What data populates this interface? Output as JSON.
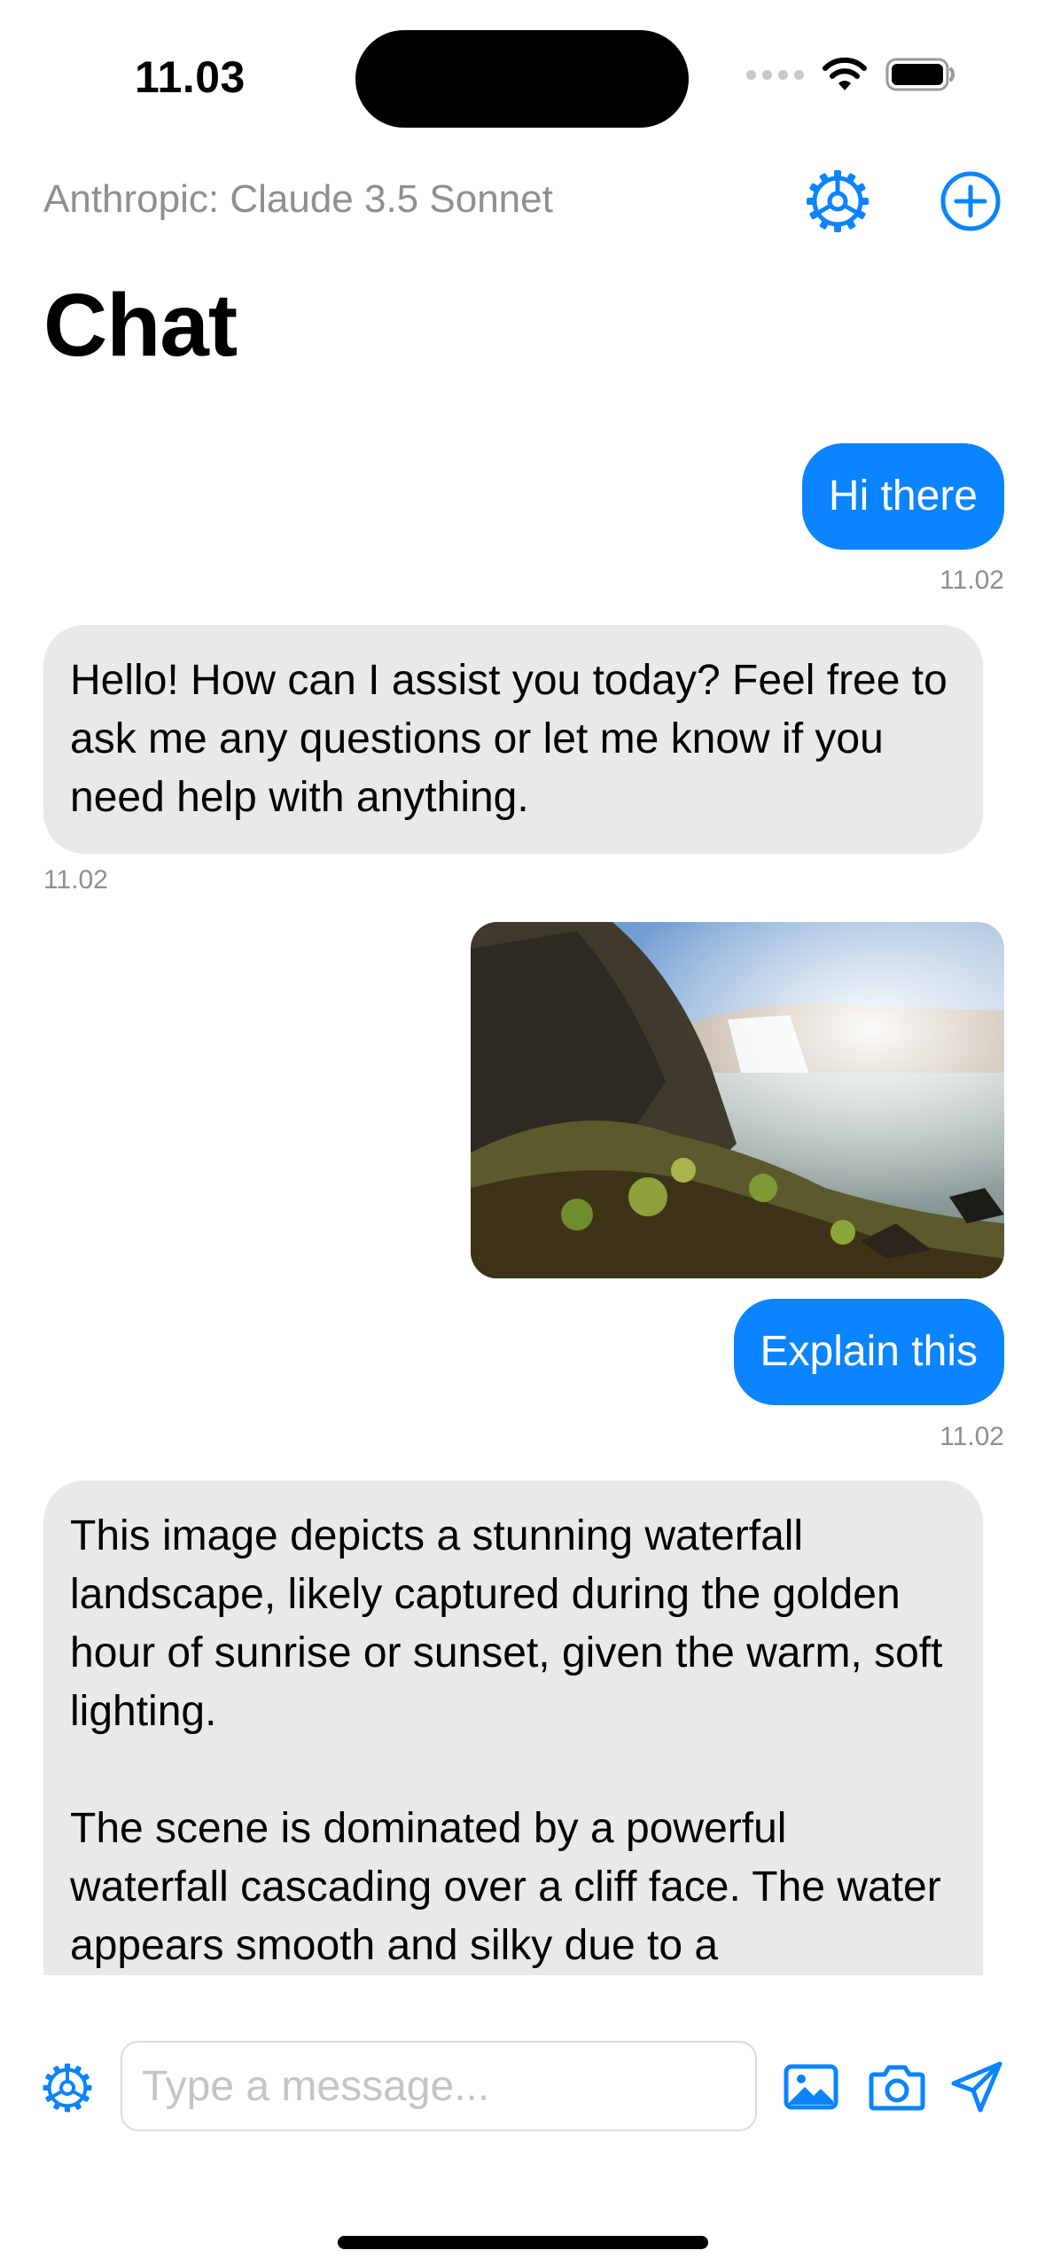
{
  "status": {
    "time": "11.03"
  },
  "nav": {
    "model_label": "Anthropic: Claude 3.5 Sonnet",
    "title": "Chat",
    "settings_icon": "gear-icon",
    "new_chat_icon": "plus-circle-icon"
  },
  "messages": [
    {
      "role": "user",
      "text": "Hi there",
      "time": "11.02"
    },
    {
      "role": "assistant",
      "text": "Hello! How can I assist you today? Feel free to ask me any questions or let me know if you need help with anything.",
      "time": "11.02"
    },
    {
      "role": "user",
      "image": "waterfall-landscape-photo",
      "text": "Explain this",
      "time": "11.02"
    },
    {
      "role": "assistant",
      "paragraphs": [
        "This image depicts a stunning waterfall landscape, likely captured during the golden hour of sunrise or sunset, given the warm, soft lighting.",
        "The scene is dominated by a powerful waterfall cascading over a cliff face. The water appears smooth and silky due to a"
      ]
    }
  ],
  "input": {
    "placeholder": "Type a message..."
  },
  "colors": {
    "accent": "#0a84ff",
    "bot_bubble": "#e9e9eb",
    "muted_text": "#8e8e93"
  }
}
